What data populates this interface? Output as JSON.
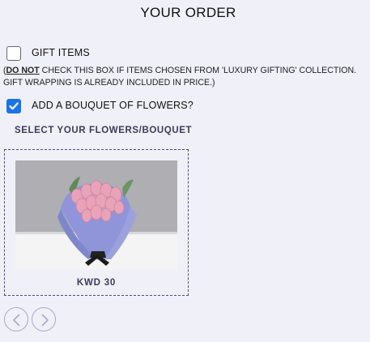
{
  "page": {
    "title": "YOUR ORDER"
  },
  "gift_items": {
    "label": "GIFT ITEMS",
    "checked": false,
    "note_prefix": "(",
    "note_emphasis": "DO NOT",
    "note_rest": " CHECK THIS BOX IF ITEMS CHOSEN FROM 'LUXURY GIFTING' COLLECTION. GIFT WRAPPING IS ALREADY INCLUDED IN PRICE.)"
  },
  "bouquet": {
    "label": "ADD A BOUQUET OF FLOWERS?",
    "checked": true
  },
  "flowers_section": {
    "heading": "SELECT YOUR FLOWERS/BOUQUET",
    "products": [
      {
        "price": "KWD 30",
        "image": "pink-tulip-bouquet-in-blue-wrap"
      }
    ]
  },
  "carousel": {
    "prev_icon": "chevron-left-icon",
    "next_icon": "chevron-right-icon"
  },
  "colors": {
    "background": "#f0f0f8",
    "accent": "#1a73e8",
    "heading": "#3c3a5a",
    "card_border": "#4a4a8a"
  }
}
